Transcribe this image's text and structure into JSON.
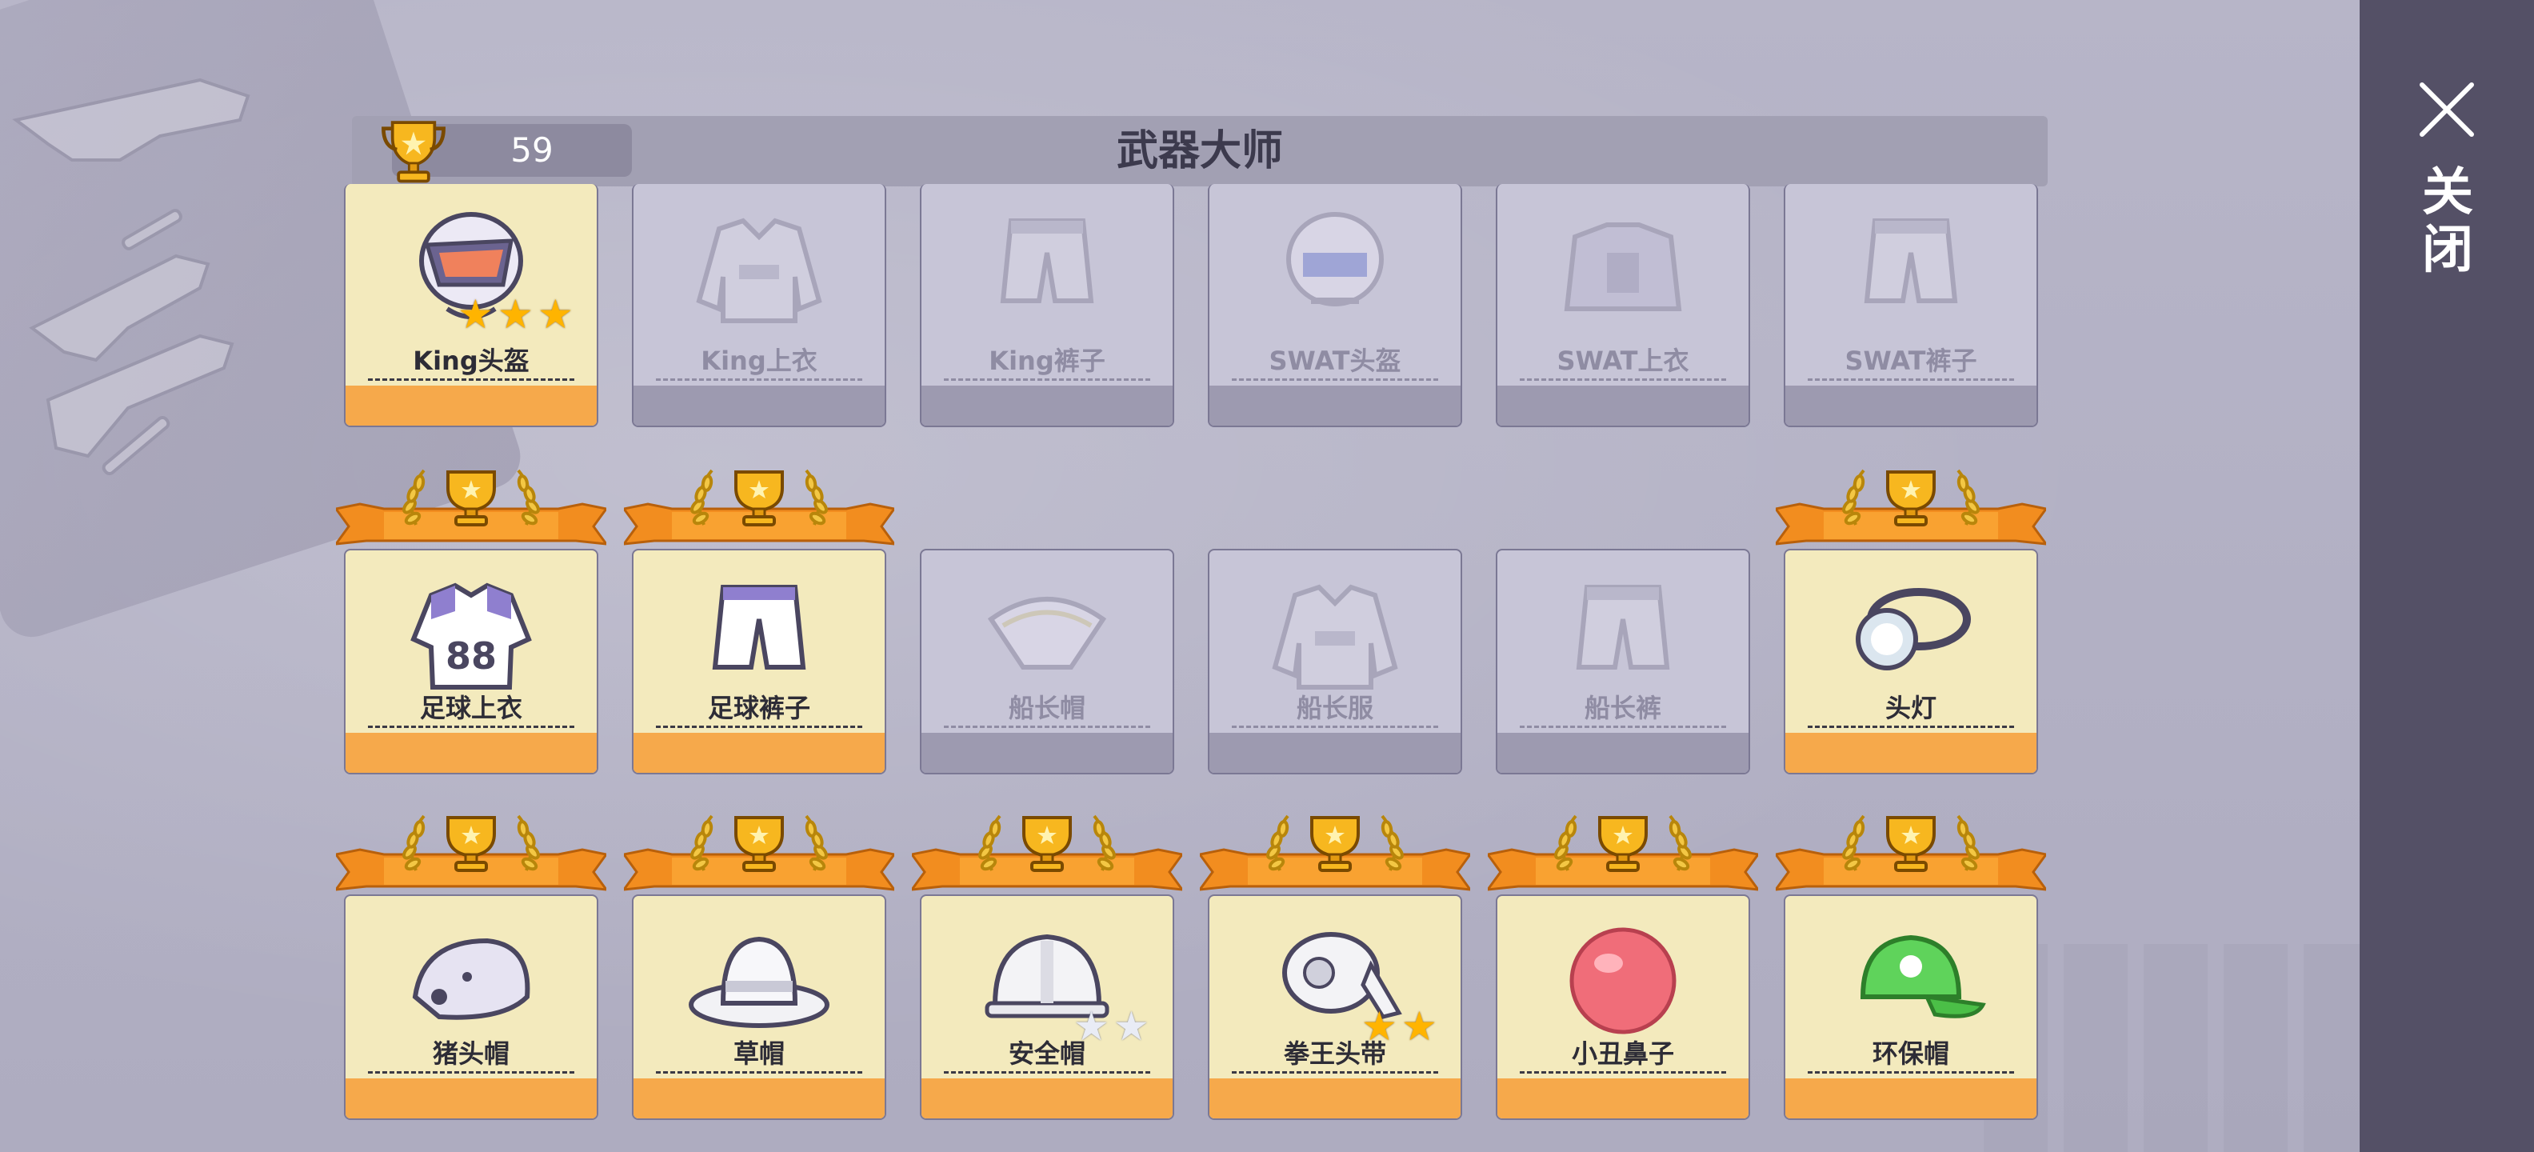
{
  "header": {
    "title": "武器大师",
    "score": "59"
  },
  "sidebar": {
    "close_label": "关闭"
  },
  "colors": {
    "gold": "#f6a94b",
    "card_earned": "#f3eabd",
    "card_locked": "#c7c5d7",
    "sidebar": "#545066"
  },
  "items": [
    {
      "name": "King头盔",
      "earned": false,
      "locked": false,
      "stars_filled": 3,
      "stars_total": 3,
      "icon": "helmet-icon"
    },
    {
      "name": "King上衣",
      "earned": false,
      "locked": true,
      "stars_filled": 0,
      "stars_total": 0,
      "icon": "jacket-icon"
    },
    {
      "name": "King裤子",
      "earned": false,
      "locked": true,
      "stars_filled": 0,
      "stars_total": 0,
      "icon": "pants-icon"
    },
    {
      "name": "SWAT头盔",
      "earned": false,
      "locked": true,
      "stars_filled": 0,
      "stars_total": 0,
      "icon": "swat-helmet-icon"
    },
    {
      "name": "SWAT上衣",
      "earned": false,
      "locked": true,
      "stars_filled": 0,
      "stars_total": 0,
      "icon": "vest-icon"
    },
    {
      "name": "SWAT裤子",
      "earned": false,
      "locked": true,
      "stars_filled": 0,
      "stars_total": 0,
      "icon": "shorts-icon"
    },
    {
      "name": "足球上衣",
      "earned": true,
      "locked": false,
      "stars_filled": 0,
      "stars_total": 0,
      "icon": "jersey-icon"
    },
    {
      "name": "足球裤子",
      "earned": true,
      "locked": false,
      "stars_filled": 0,
      "stars_total": 0,
      "icon": "shorts-icon"
    },
    {
      "name": "船长帽",
      "earned": false,
      "locked": true,
      "stars_filled": 0,
      "stars_total": 0,
      "icon": "tricorn-hat-icon"
    },
    {
      "name": "船长服",
      "earned": false,
      "locked": true,
      "stars_filled": 0,
      "stars_total": 0,
      "icon": "coat-icon"
    },
    {
      "name": "船长裤",
      "earned": false,
      "locked": true,
      "stars_filled": 0,
      "stars_total": 0,
      "icon": "shorts-icon"
    },
    {
      "name": "头灯",
      "earned": true,
      "locked": false,
      "stars_filled": 0,
      "stars_total": 0,
      "icon": "headlamp-icon"
    },
    {
      "name": "猪头帽",
      "earned": true,
      "locked": false,
      "stars_filled": 0,
      "stars_total": 0,
      "icon": "boar-hat-icon"
    },
    {
      "name": "草帽",
      "earned": true,
      "locked": false,
      "stars_filled": 0,
      "stars_total": 0,
      "icon": "bucket-hat-icon"
    },
    {
      "name": "安全帽",
      "earned": true,
      "locked": false,
      "stars_filled": 0,
      "stars_total": 2,
      "icon": "hard-hat-icon"
    },
    {
      "name": "拳王头带",
      "earned": true,
      "locked": false,
      "stars_filled": 2,
      "stars_total": 2,
      "icon": "headband-icon"
    },
    {
      "name": "小丑鼻子",
      "earned": true,
      "locked": false,
      "stars_filled": 0,
      "stars_total": 0,
      "icon": "clown-nose-icon"
    },
    {
      "name": "环保帽",
      "earned": true,
      "locked": false,
      "stars_filled": 0,
      "stars_total": 0,
      "icon": "cap-icon"
    }
  ]
}
